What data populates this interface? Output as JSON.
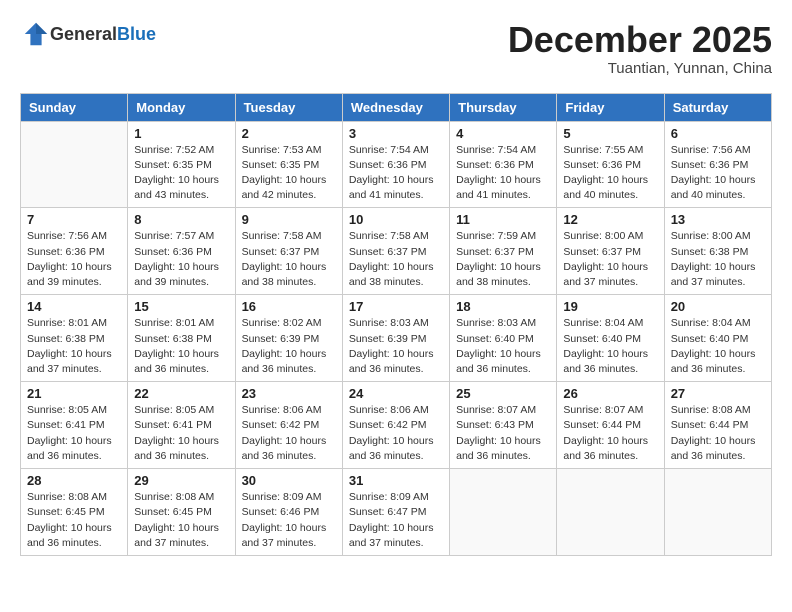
{
  "header": {
    "logo_general": "General",
    "logo_blue": "Blue",
    "month_year": "December 2025",
    "location": "Tuantian, Yunnan, China"
  },
  "days_of_week": [
    "Sunday",
    "Monday",
    "Tuesday",
    "Wednesday",
    "Thursday",
    "Friday",
    "Saturday"
  ],
  "weeks": [
    [
      {
        "num": "",
        "detail": ""
      },
      {
        "num": "1",
        "detail": "Sunrise: 7:52 AM\nSunset: 6:35 PM\nDaylight: 10 hours\nand 43 minutes."
      },
      {
        "num": "2",
        "detail": "Sunrise: 7:53 AM\nSunset: 6:35 PM\nDaylight: 10 hours\nand 42 minutes."
      },
      {
        "num": "3",
        "detail": "Sunrise: 7:54 AM\nSunset: 6:36 PM\nDaylight: 10 hours\nand 41 minutes."
      },
      {
        "num": "4",
        "detail": "Sunrise: 7:54 AM\nSunset: 6:36 PM\nDaylight: 10 hours\nand 41 minutes."
      },
      {
        "num": "5",
        "detail": "Sunrise: 7:55 AM\nSunset: 6:36 PM\nDaylight: 10 hours\nand 40 minutes."
      },
      {
        "num": "6",
        "detail": "Sunrise: 7:56 AM\nSunset: 6:36 PM\nDaylight: 10 hours\nand 40 minutes."
      }
    ],
    [
      {
        "num": "7",
        "detail": "Sunrise: 7:56 AM\nSunset: 6:36 PM\nDaylight: 10 hours\nand 39 minutes."
      },
      {
        "num": "8",
        "detail": "Sunrise: 7:57 AM\nSunset: 6:36 PM\nDaylight: 10 hours\nand 39 minutes."
      },
      {
        "num": "9",
        "detail": "Sunrise: 7:58 AM\nSunset: 6:37 PM\nDaylight: 10 hours\nand 38 minutes."
      },
      {
        "num": "10",
        "detail": "Sunrise: 7:58 AM\nSunset: 6:37 PM\nDaylight: 10 hours\nand 38 minutes."
      },
      {
        "num": "11",
        "detail": "Sunrise: 7:59 AM\nSunset: 6:37 PM\nDaylight: 10 hours\nand 38 minutes."
      },
      {
        "num": "12",
        "detail": "Sunrise: 8:00 AM\nSunset: 6:37 PM\nDaylight: 10 hours\nand 37 minutes."
      },
      {
        "num": "13",
        "detail": "Sunrise: 8:00 AM\nSunset: 6:38 PM\nDaylight: 10 hours\nand 37 minutes."
      }
    ],
    [
      {
        "num": "14",
        "detail": "Sunrise: 8:01 AM\nSunset: 6:38 PM\nDaylight: 10 hours\nand 37 minutes."
      },
      {
        "num": "15",
        "detail": "Sunrise: 8:01 AM\nSunset: 6:38 PM\nDaylight: 10 hours\nand 36 minutes."
      },
      {
        "num": "16",
        "detail": "Sunrise: 8:02 AM\nSunset: 6:39 PM\nDaylight: 10 hours\nand 36 minutes."
      },
      {
        "num": "17",
        "detail": "Sunrise: 8:03 AM\nSunset: 6:39 PM\nDaylight: 10 hours\nand 36 minutes."
      },
      {
        "num": "18",
        "detail": "Sunrise: 8:03 AM\nSunset: 6:40 PM\nDaylight: 10 hours\nand 36 minutes."
      },
      {
        "num": "19",
        "detail": "Sunrise: 8:04 AM\nSunset: 6:40 PM\nDaylight: 10 hours\nand 36 minutes."
      },
      {
        "num": "20",
        "detail": "Sunrise: 8:04 AM\nSunset: 6:40 PM\nDaylight: 10 hours\nand 36 minutes."
      }
    ],
    [
      {
        "num": "21",
        "detail": "Sunrise: 8:05 AM\nSunset: 6:41 PM\nDaylight: 10 hours\nand 36 minutes."
      },
      {
        "num": "22",
        "detail": "Sunrise: 8:05 AM\nSunset: 6:41 PM\nDaylight: 10 hours\nand 36 minutes."
      },
      {
        "num": "23",
        "detail": "Sunrise: 8:06 AM\nSunset: 6:42 PM\nDaylight: 10 hours\nand 36 minutes."
      },
      {
        "num": "24",
        "detail": "Sunrise: 8:06 AM\nSunset: 6:42 PM\nDaylight: 10 hours\nand 36 minutes."
      },
      {
        "num": "25",
        "detail": "Sunrise: 8:07 AM\nSunset: 6:43 PM\nDaylight: 10 hours\nand 36 minutes."
      },
      {
        "num": "26",
        "detail": "Sunrise: 8:07 AM\nSunset: 6:44 PM\nDaylight: 10 hours\nand 36 minutes."
      },
      {
        "num": "27",
        "detail": "Sunrise: 8:08 AM\nSunset: 6:44 PM\nDaylight: 10 hours\nand 36 minutes."
      }
    ],
    [
      {
        "num": "28",
        "detail": "Sunrise: 8:08 AM\nSunset: 6:45 PM\nDaylight: 10 hours\nand 36 minutes."
      },
      {
        "num": "29",
        "detail": "Sunrise: 8:08 AM\nSunset: 6:45 PM\nDaylight: 10 hours\nand 37 minutes."
      },
      {
        "num": "30",
        "detail": "Sunrise: 8:09 AM\nSunset: 6:46 PM\nDaylight: 10 hours\nand 37 minutes."
      },
      {
        "num": "31",
        "detail": "Sunrise: 8:09 AM\nSunset: 6:47 PM\nDaylight: 10 hours\nand 37 minutes."
      },
      {
        "num": "",
        "detail": ""
      },
      {
        "num": "",
        "detail": ""
      },
      {
        "num": "",
        "detail": ""
      }
    ]
  ]
}
